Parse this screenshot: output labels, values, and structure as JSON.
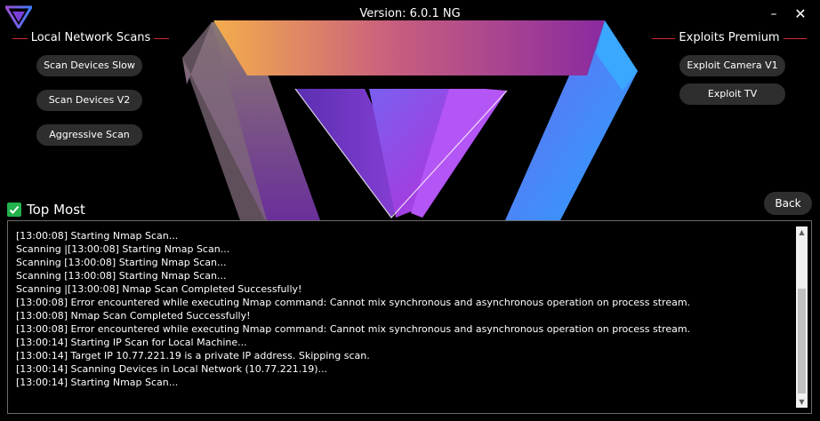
{
  "window": {
    "title": "Version: 6.0.1 NG",
    "minimize_glyph": "–",
    "close_glyph": "✕"
  },
  "left_section": {
    "header": "Local Network Scans",
    "buttons": [
      "Scan Devices Slow",
      "Scan Devices V2",
      "Aggressive Scan"
    ]
  },
  "right_section": {
    "header": "Exploits Premium",
    "buttons": [
      "Exploit Camera V1",
      "Exploit TV"
    ]
  },
  "back_button": "Back",
  "top_most": {
    "label": "Top Most",
    "checked": true
  },
  "log": {
    "lines": [
      "[13:00:08] Starting Nmap Scan...",
      "Scanning |[13:00:08] Starting Nmap Scan...",
      "Scanning [13:00:08] Starting Nmap Scan...",
      "Scanning [13:00:08] Starting Nmap Scan...",
      "Scanning |[13:00:08] Nmap Scan Completed Successfully!",
      "[13:00:08] Error encountered while executing Nmap command: Cannot mix synchronous and asynchronous operation on process stream.",
      "[13:00:08] Nmap Scan Completed Successfully!",
      "[13:00:08] Error encountered while executing Nmap command: Cannot mix synchronous and asynchronous operation on process stream.",
      "[13:00:14] Starting IP Scan for Local Machine...",
      "[13:00:14] Target IP 10.77.221.19 is a private IP address. Skipping scan.",
      "[13:00:14] Scanning Devices in Local Network (10.77.221.19)...",
      "[13:00:14] Starting Nmap Scan..."
    ]
  },
  "colors": {
    "accent_line": "#d02828",
    "checkbox": "#22b14c",
    "button_bg": "#2e2e2e",
    "logo_gradient": [
      "#f4a84a",
      "#b04fa8",
      "#7a2fd8",
      "#2a8cff"
    ]
  },
  "icons": {
    "app_logo": "v-logo-icon",
    "hero": "v-logo-large",
    "check": "checkmark-icon",
    "scroll_up": "chevron-up-icon",
    "scroll_down": "chevron-down-icon"
  }
}
